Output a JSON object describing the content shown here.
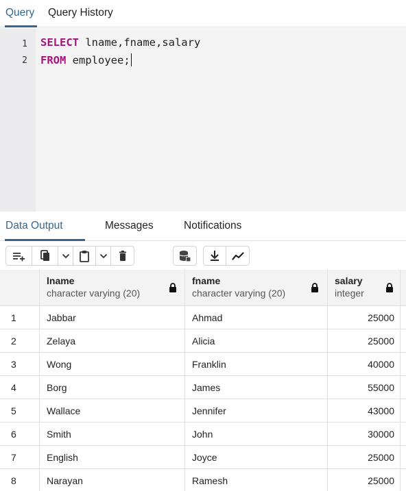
{
  "query_tabs": [
    {
      "label": "Query",
      "active": true
    },
    {
      "label": "Query History",
      "active": false
    }
  ],
  "editor": {
    "line_numbers": [
      "1",
      "2"
    ],
    "line1": {
      "kw": "SELECT",
      "rest": " lname,fname,salary"
    },
    "line2": {
      "kw": "FROM",
      "rest": " employee;"
    }
  },
  "output_tabs": [
    {
      "label": "Data Output",
      "active": true
    },
    {
      "label": "Messages",
      "active": false
    },
    {
      "label": "Notifications",
      "active": false
    }
  ],
  "toolbar": {
    "icons": [
      "add-row-icon",
      "copy-icon",
      "chevron-down-icon",
      "paste-icon",
      "chevron-down-icon",
      "delete-icon",
      "save-data-icon",
      "download-icon",
      "graph-visualiser-icon"
    ]
  },
  "grid": {
    "columns": [
      {
        "name": "lname",
        "type": "character varying (20)"
      },
      {
        "name": "fname",
        "type": "character varying (20)"
      },
      {
        "name": "salary",
        "type": "integer"
      }
    ],
    "rows": [
      {
        "n": "1",
        "lname": "Jabbar",
        "fname": "Ahmad",
        "salary": "25000"
      },
      {
        "n": "2",
        "lname": "Zelaya",
        "fname": "Alicia",
        "salary": "25000"
      },
      {
        "n": "3",
        "lname": "Wong",
        "fname": "Franklin",
        "salary": "40000"
      },
      {
        "n": "4",
        "lname": "Borg",
        "fname": "James",
        "salary": "55000"
      },
      {
        "n": "5",
        "lname": "Wallace",
        "fname": "Jennifer",
        "salary": "43000"
      },
      {
        "n": "6",
        "lname": "Smith",
        "fname": "John",
        "salary": "30000"
      },
      {
        "n": "7",
        "lname": "English",
        "fname": "Joyce",
        "salary": "25000"
      },
      {
        "n": "8",
        "lname": "Narayan",
        "fname": "Ramesh",
        "salary": "25000"
      }
    ]
  },
  "colors": {
    "accent": "#326690",
    "keyword": "#a3147d",
    "editor_bg": "#f3f3f4"
  }
}
